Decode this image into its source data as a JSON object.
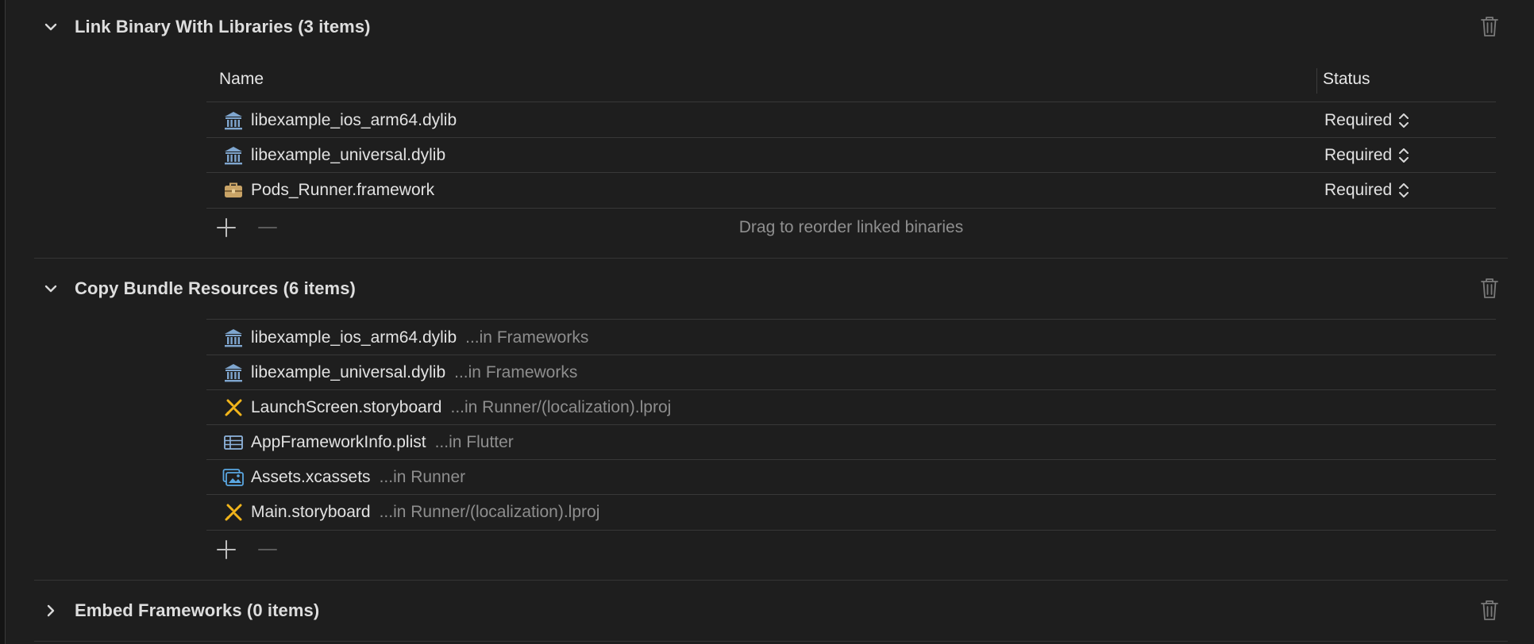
{
  "sections": {
    "link": {
      "title": "Link Binary With Libraries (3 items)",
      "expanded": true,
      "columns": {
        "name": "Name",
        "status": "Status"
      },
      "rows": [
        {
          "name": "libexample_ios_arm64.dylib",
          "icon": "library-icon",
          "status": "Required"
        },
        {
          "name": "libexample_universal.dylib",
          "icon": "library-icon",
          "status": "Required"
        },
        {
          "name": "Pods_Runner.framework",
          "icon": "framework-toolbox-icon",
          "status": "Required"
        }
      ],
      "hint": "Drag to reorder linked binaries"
    },
    "copy": {
      "title": "Copy Bundle Resources (6 items)",
      "expanded": true,
      "rows": [
        {
          "name": "libexample_ios_arm64.dylib",
          "location": "...in Frameworks",
          "icon": "library-icon"
        },
        {
          "name": "libexample_universal.dylib",
          "location": "...in Frameworks",
          "icon": "library-icon"
        },
        {
          "name": "LaunchScreen.storyboard",
          "location": "...in Runner/(localization).lproj",
          "icon": "storyboard-icon"
        },
        {
          "name": "AppFrameworkInfo.plist",
          "location": "...in Flutter",
          "icon": "plist-table-icon"
        },
        {
          "name": "Assets.xcassets",
          "location": "...in Runner",
          "icon": "asset-catalog-icon"
        },
        {
          "name": "Main.storyboard",
          "location": "...in Runner/(localization).lproj",
          "icon": "storyboard-icon"
        }
      ]
    },
    "embed": {
      "title": "Embed Frameworks (0 items)",
      "expanded": false
    }
  },
  "colors": {
    "background": "#1e1e1e",
    "library_icon": "#7fa6cf",
    "framework_icon": "#c9a467",
    "storyboard_icon": "#f2b51b",
    "plist_icon": "#8fb5de",
    "assets_icon": "#5aa7e2",
    "secondary_text": "#8e8e8e"
  }
}
